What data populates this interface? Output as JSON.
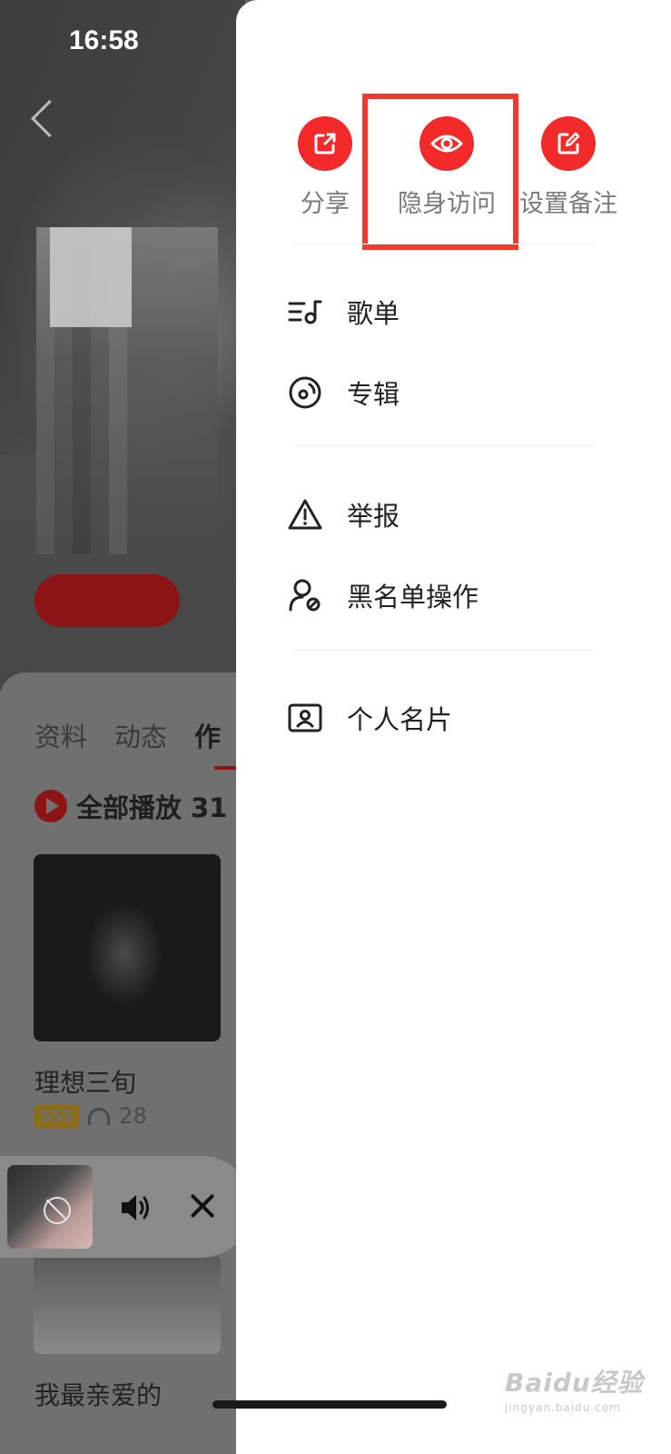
{
  "status_bar": {
    "time": "16:58"
  },
  "profile": {
    "tabs": [
      {
        "label": "资料"
      },
      {
        "label": "动态"
      },
      {
        "label": "作"
      }
    ],
    "play_all_label": "全部播放 31",
    "albums": [
      {
        "title": "理想三旬",
        "badge": "SSS",
        "plays": "28"
      },
      {
        "title": "我最亲爱的"
      }
    ]
  },
  "mini_player": {
    "thumb_icon": "mute-icon",
    "speaker_icon": "speaker-icon",
    "close_icon": "close-icon"
  },
  "drawer": {
    "quick_actions": [
      {
        "label": "分享",
        "icon": "share-icon"
      },
      {
        "label": "隐身访问",
        "icon": "eye-icon"
      },
      {
        "label": "设置备注",
        "icon": "edit-icon"
      }
    ],
    "menu": [
      {
        "label": "歌单",
        "icon": "playlist-icon"
      },
      {
        "label": "专辑",
        "icon": "album-icon"
      },
      {
        "label": "举报",
        "icon": "warning-icon"
      },
      {
        "label": "黑名单操作",
        "icon": "user-block-icon"
      },
      {
        "label": "个人名片",
        "icon": "profile-card-icon"
      }
    ],
    "highlight_color": "#ef3b2f",
    "accent_color": "#f22a2a"
  },
  "watermark": {
    "brand": "Baidu经验",
    "url": "jingyan.baidu.com"
  }
}
